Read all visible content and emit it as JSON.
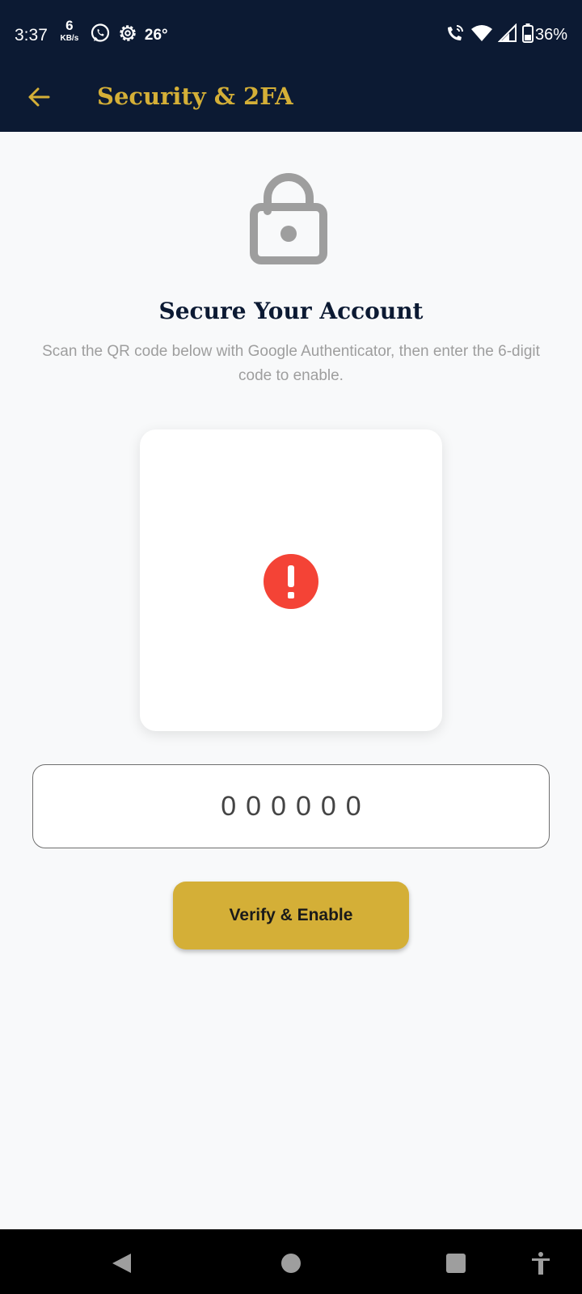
{
  "status_bar": {
    "time": "3:37",
    "net_speed_value": "6",
    "net_speed_unit": "KB/s",
    "temperature": "26°",
    "battery": "36%",
    "icons": [
      "whatsapp-icon",
      "settings-gear-icon",
      "wifi-calling-icon",
      "wifi-icon",
      "cellular-signal-icon",
      "battery-icon"
    ]
  },
  "app_bar": {
    "title": "Security & 2FA",
    "back_icon": "arrow-back-icon"
  },
  "main": {
    "lock_icon": "lock-open-icon",
    "heading": "Secure Your Account",
    "instructions": "Scan the QR code below with Google Authenticator, then enter the 6-digit code to enable.",
    "qr_error_icon": "error-icon",
    "code_input": {
      "value": "",
      "placeholder": "000000"
    },
    "verify_button_label": "Verify & Enable"
  },
  "nav_bar": {
    "icons": [
      "back-triangle-icon",
      "home-circle-icon",
      "recents-square-icon",
      "accessibility-icon"
    ]
  },
  "colors": {
    "header_bg": "#0c1a33",
    "accent_gold": "#d4af37",
    "error_red": "#f44336",
    "page_bg": "#f8f9fa"
  }
}
